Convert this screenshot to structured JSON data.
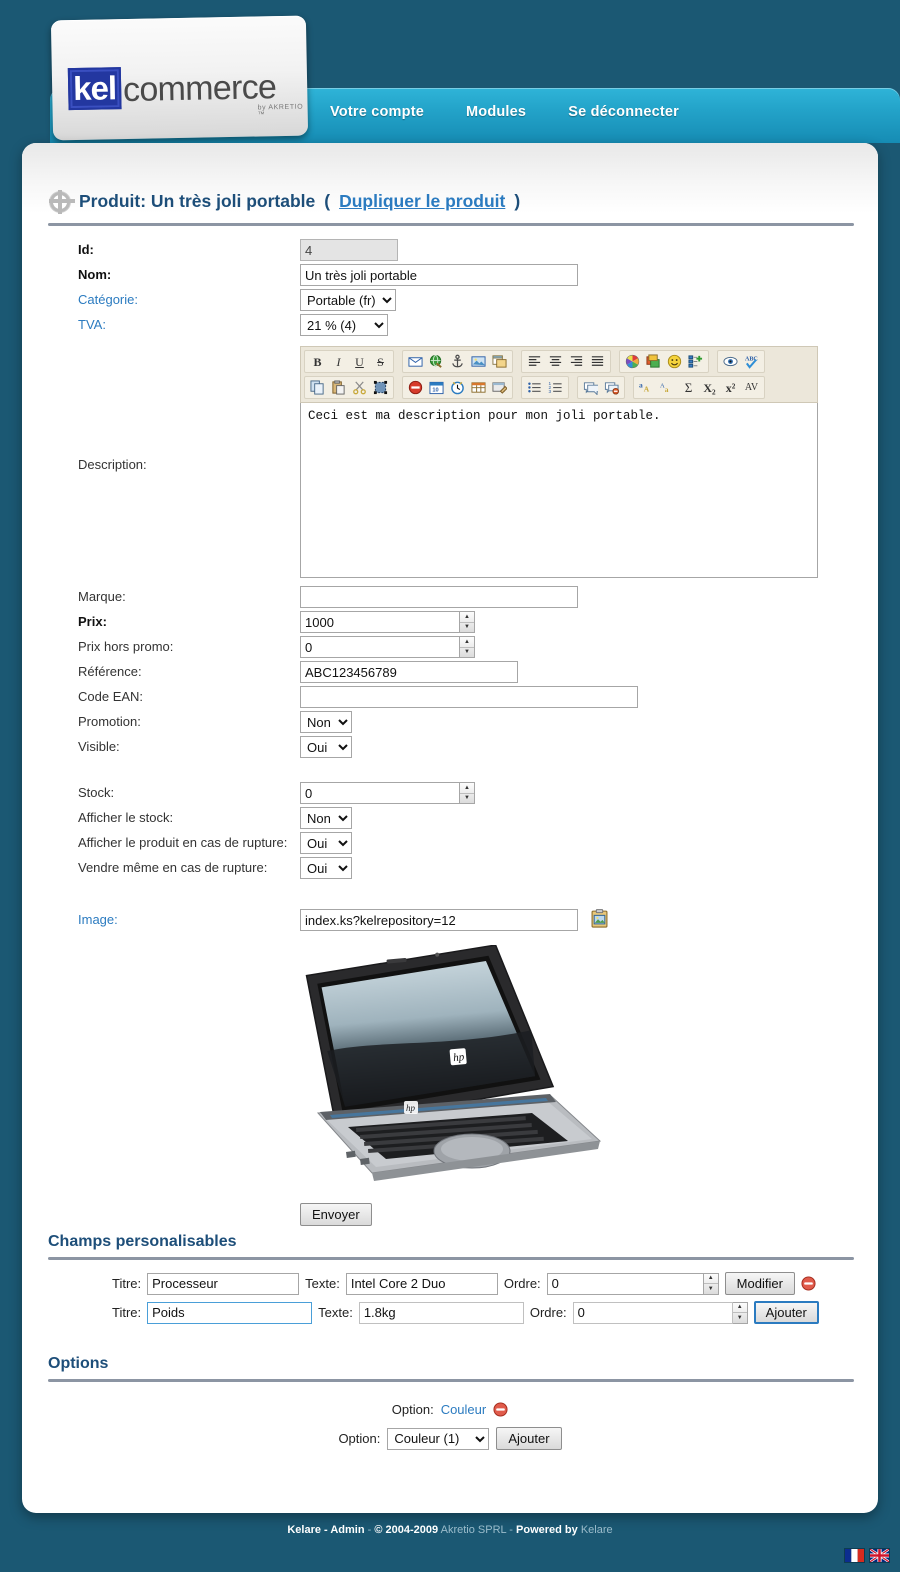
{
  "brand": {
    "logo_prefix": "kel",
    "logo_suffix": "commerce",
    "logo_sub": "by AKRETIO ™"
  },
  "nav": {
    "items": [
      {
        "label": "Votre compte"
      },
      {
        "label": "Modules"
      },
      {
        "label": "Se déconnecter"
      }
    ]
  },
  "page": {
    "title_prefix": "Produit: Un très joli portable",
    "paren_open": "(",
    "duplicate_link": "Dupliquer le produit",
    "paren_close": ")"
  },
  "form": {
    "id": {
      "label": "Id:",
      "value": "4"
    },
    "nom": {
      "label": "Nom:",
      "value": "Un très joli portable"
    },
    "categorie": {
      "label": "Catégorie:",
      "value": "Portable (fr)"
    },
    "tva": {
      "label": "TVA:",
      "value": "21 % (4)"
    },
    "description": {
      "label": "Description:",
      "value": "Ceci est ma description pour mon joli portable."
    },
    "marque": {
      "label": "Marque:",
      "value": ""
    },
    "prix": {
      "label": "Prix:",
      "value": "1000"
    },
    "prix_hors_promo": {
      "label": "Prix hors promo:",
      "value": "0"
    },
    "reference": {
      "label": "Référence:",
      "value": "ABC123456789"
    },
    "code_ean": {
      "label": "Code EAN:",
      "value": ""
    },
    "promotion": {
      "label": "Promotion:",
      "value": "Non"
    },
    "visible": {
      "label": "Visible:",
      "value": "Oui"
    },
    "stock": {
      "label": "Stock:",
      "value": "0"
    },
    "afficher_stock": {
      "label": "Afficher le stock:",
      "value": "Non"
    },
    "afficher_rupture": {
      "label": "Afficher le produit en cas de rupture:",
      "value": "Oui"
    },
    "vendre_rupture": {
      "label": "Vendre même en cas de rupture:",
      "value": "Oui"
    },
    "image": {
      "label": "Image:",
      "value": "index.ks?kelrepository=12"
    },
    "submit_label": "Envoyer"
  },
  "editor": {
    "rows": [
      {
        "groups": [
          {
            "buttons": [
              {
                "icon": "bold-icon",
                "glyph": "B"
              },
              {
                "icon": "italic-icon",
                "glyph": "I"
              },
              {
                "icon": "underline-icon",
                "glyph": "U"
              },
              {
                "icon": "strikethrough-icon",
                "glyph": "S"
              }
            ]
          },
          {
            "buttons": [
              {
                "icon": "email-link-icon"
              },
              {
                "icon": "web-link-icon"
              },
              {
                "icon": "anchor-icon"
              },
              {
                "icon": "insert-image-icon"
              },
              {
                "icon": "insert-window-icon"
              }
            ]
          },
          {
            "buttons": [
              {
                "icon": "align-left-icon"
              },
              {
                "icon": "align-center-icon"
              },
              {
                "icon": "align-right-icon"
              },
              {
                "icon": "align-justify-icon"
              }
            ]
          },
          {
            "buttons": [
              {
                "icon": "color-wheel-icon"
              },
              {
                "icon": "background-color-icon"
              },
              {
                "icon": "smiley-icon"
              },
              {
                "icon": "insert-node-icon"
              }
            ]
          },
          {
            "buttons": [
              {
                "icon": "preview-eye-icon"
              },
              {
                "icon": "spellcheck-abc-icon"
              }
            ]
          }
        ]
      },
      {
        "groups": [
          {
            "buttons": [
              {
                "icon": "copy-icon"
              },
              {
                "icon": "paste-icon"
              },
              {
                "icon": "cut-scissors-icon"
              },
              {
                "icon": "select-all-icon"
              }
            ]
          },
          {
            "buttons": [
              {
                "icon": "remove-format-icon"
              },
              {
                "icon": "insert-date-icon"
              },
              {
                "icon": "insert-time-icon"
              },
              {
                "icon": "insert-table-icon"
              },
              {
                "icon": "edit-source-icon"
              }
            ]
          },
          {
            "buttons": [
              {
                "icon": "bulleted-list-icon"
              },
              {
                "icon": "numbered-list-icon"
              }
            ]
          },
          {
            "buttons": [
              {
                "icon": "comment-icon"
              },
              {
                "icon": "comment-remove-icon"
              }
            ]
          },
          {
            "buttons": [
              {
                "icon": "font-style-a-icon"
              },
              {
                "icon": "font-size-a-icon"
              },
              {
                "icon": "sigma-icon",
                "glyph": "Σ"
              },
              {
                "icon": "subscript-icon",
                "glyph": "X₂"
              },
              {
                "icon": "superscript-icon",
                "glyph": "x²"
              },
              {
                "icon": "character-spacing-icon",
                "glyph": "AV"
              }
            ]
          }
        ]
      }
    ]
  },
  "custom_fields": {
    "heading": "Champs personalisables",
    "labels": {
      "titre": "Titre:",
      "texte": "Texte:",
      "ordre": "Ordre:"
    },
    "rows": [
      {
        "titre": "Processeur",
        "texte": "Intel Core 2 Duo",
        "ordre": "0",
        "button": "Modifier",
        "has_delete": true,
        "focused": false
      },
      {
        "titre": "Poids",
        "texte": "1.8kg",
        "ordre": "0",
        "button": "Ajouter",
        "has_delete": false,
        "focused": true
      }
    ]
  },
  "options": {
    "heading": "Options",
    "existing_label": "Option:",
    "existing_value": "Couleur",
    "select_label": "Option:",
    "select_value": "Couleur (1)",
    "add_button": "Ajouter"
  },
  "footer": {
    "admin": "Kelare - Admin",
    "sep1": "-",
    "copyright": "© 2004-2009",
    "company": "Akretio SPRL",
    "sep2": "-",
    "powered": "Powered by",
    "powered_by": "Kelare",
    "flags": [
      {
        "name": "flag-fr"
      },
      {
        "name": "flag-en"
      }
    ]
  },
  "colors": {
    "page_bg": "#1b5873",
    "nav_accent": "#23a3c9",
    "heading": "#1d4e79",
    "link": "#2b7bc0"
  }
}
